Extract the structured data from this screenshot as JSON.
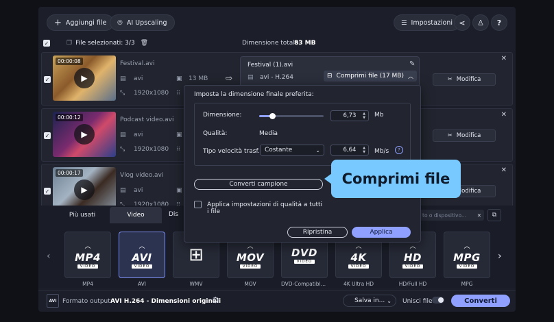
{
  "toolbar": {
    "add_files": "Aggiungi file",
    "ai_upscaling": "AI Upscaling",
    "settings": "Impostazioni"
  },
  "selection_bar": {
    "selected": "File selezionati: 3/3",
    "total_size_label": "Dimensione totale:",
    "total_size_value": "83 MB"
  },
  "files": [
    {
      "name": "Festival.avi",
      "duration": "00:00:08",
      "format": "avi",
      "size": "13 MB",
      "resolution": "1920x1080"
    },
    {
      "name": "Podcast video.avi",
      "duration": "00:00:12",
      "format": "avi",
      "resolution": "1920x1080"
    },
    {
      "name": "Vlog video.avi",
      "duration": "00:00:17",
      "format": "avi",
      "resolution": "1920x1080"
    }
  ],
  "edit_label": "Modifica",
  "output_card": {
    "filename": "Festival (1).avi",
    "codec": "avi - H.264",
    "compress": "Comprimi file (17 MB)"
  },
  "compress_popup": {
    "title": "Imposta la dimensione finale preferita:",
    "size_label": "Dimensione:",
    "size_value": "6,73",
    "size_unit": "Mb",
    "size_slider_fraction": 0.2,
    "quality_label": "Qualità:",
    "quality_value": "Media",
    "bitrate_type_label": "Tipo velocità trasf.:",
    "bitrate_type_value": "Costante",
    "bitrate_value": "6,64",
    "bitrate_unit": "Mb/s",
    "convert_sample": "Converti campione",
    "apply_all": "Applica impostazioni di qualità a tutti i file",
    "reset": "Ripristina",
    "apply": "Applica"
  },
  "callout": "Comprimi file",
  "format_tabs": {
    "popular": "Più usati",
    "video": "Video",
    "devices": "Dis"
  },
  "device_search_placeholder": "to o dispositivo...",
  "formats": [
    {
      "big": "MP4",
      "sub": "VIDEO",
      "label": "MP4"
    },
    {
      "big": "AVI",
      "sub": "VIDEO",
      "label": "AVI"
    },
    {
      "big": "",
      "sub": "",
      "label": "WMV"
    },
    {
      "big": "MOV",
      "sub": "VIDEO",
      "label": "MOV"
    },
    {
      "big": "DVD",
      "sub": "VIDEO",
      "label": "DVD-Compatible ..."
    },
    {
      "big": "4K",
      "sub": "VIDEO",
      "label": "4K Ultra HD"
    },
    {
      "big": "HD",
      "sub": "VIDEO",
      "label": "HD/Full HD"
    },
    {
      "big": "MPG",
      "sub": "VIDEO",
      "label": "MPG"
    }
  ],
  "bottom": {
    "output_label": "Formato output:",
    "output_value": "AVI H.264 - Dimensioni originali",
    "save_in": "Salva in...",
    "merge": "Unisci file:",
    "convert": "Converti"
  },
  "colors": {
    "accent": "#8fa0ff",
    "callout": "#78c9ff"
  }
}
